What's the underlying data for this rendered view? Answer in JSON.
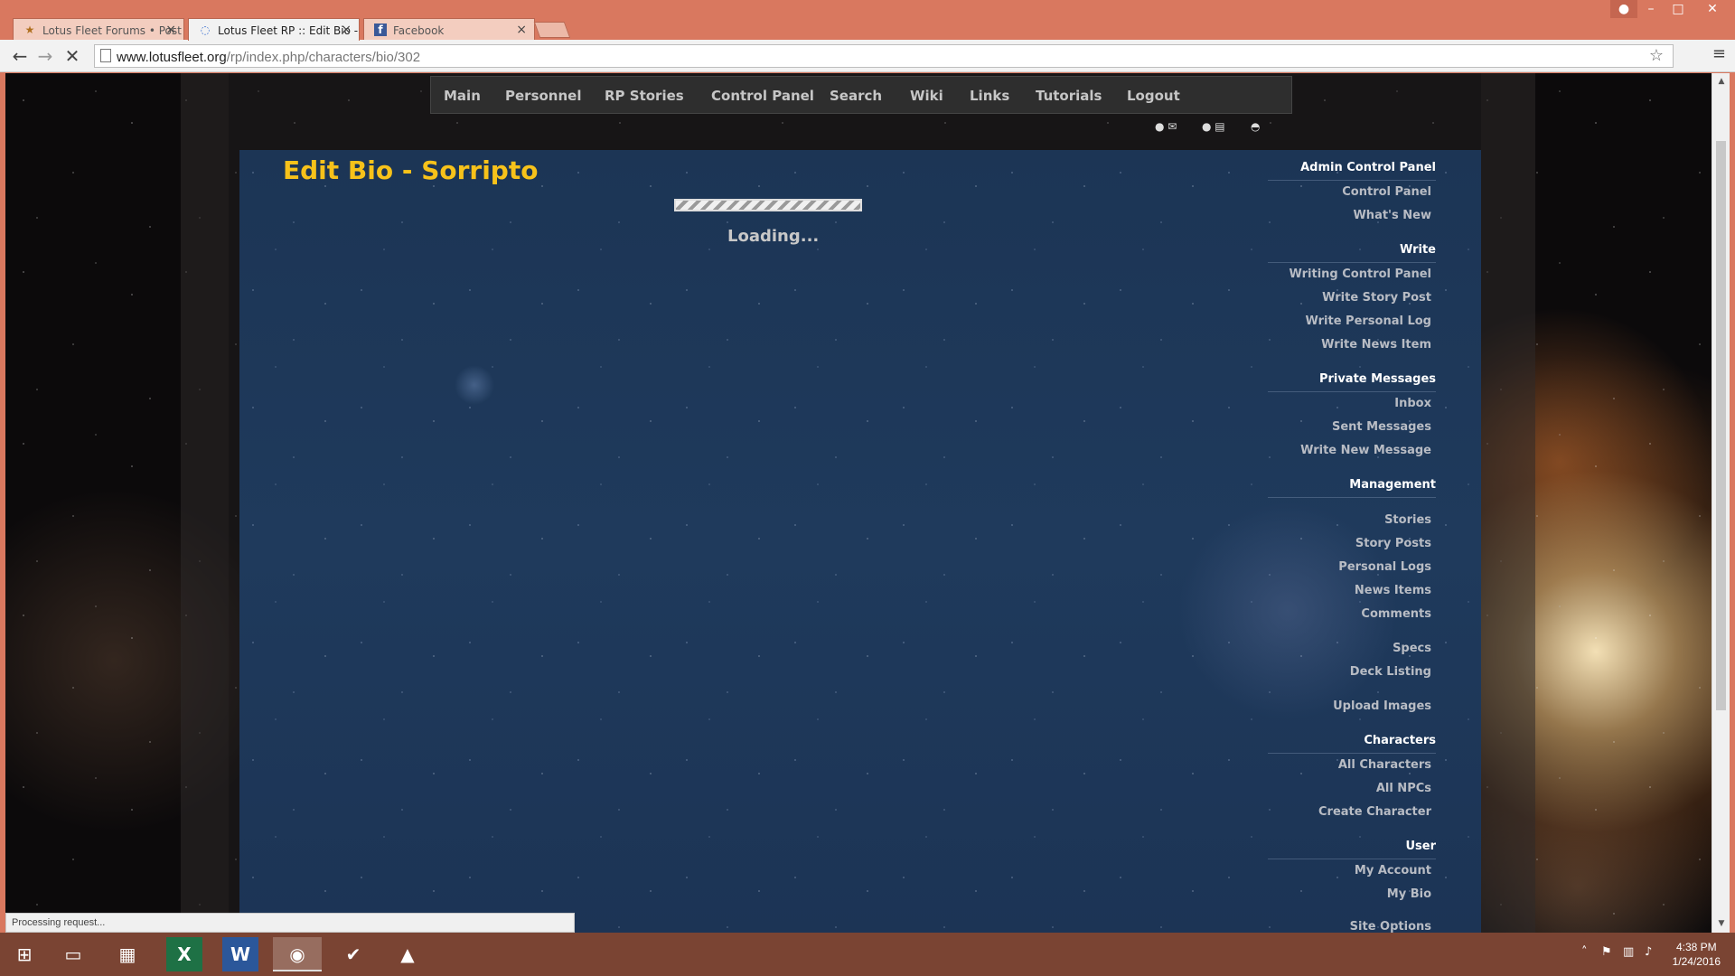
{
  "browser": {
    "tabs": [
      {
        "label": "Lotus Fleet Forums • Post",
        "icon": "star-favicon-icon"
      },
      {
        "label": "Lotus Fleet RP :: Edit Bio -",
        "icon": "loading-spinner-icon"
      },
      {
        "label": "Facebook",
        "icon": "facebook-favicon-icon"
      }
    ],
    "url_domain": "www.lotusfleet.org",
    "url_path": "/rp/index.php/characters/bio/302",
    "status_text": "Processing request..."
  },
  "nav": {
    "items": [
      "Main",
      "Personnel",
      "RP Stories",
      "Control Panel",
      "Search",
      "Wiki",
      "Links",
      "Tutorials",
      "Logout"
    ]
  },
  "page": {
    "title": "Edit Bio - Sorripto",
    "loading_text": "Loading..."
  },
  "sidebar": {
    "admin_head": "Admin Control Panel",
    "admin_control_panel": "Control Panel",
    "admin_whats_new": "What's New",
    "write_head": "Write",
    "writing_control_panel": "Writing Control Panel",
    "write_story_post": "Write Story Post",
    "write_personal_log": "Write Personal Log",
    "write_news_item": "Write News Item",
    "pm_head": "Private Messages",
    "pm_inbox": "Inbox",
    "pm_sent": "Sent Messages",
    "pm_new": "Write New Message",
    "mgmt_head": "Management",
    "mgmt_stories": "Stories",
    "mgmt_story_posts": "Story Posts",
    "mgmt_personal_logs": "Personal Logs",
    "mgmt_news_items": "News Items",
    "mgmt_comments": "Comments",
    "mgmt_specs": "Specs",
    "mgmt_deck_listing": "Deck Listing",
    "mgmt_upload_images": "Upload Images",
    "chars_head": "Characters",
    "chars_all": "All Characters",
    "chars_npcs": "All NPCs",
    "chars_create": "Create Character",
    "user_head": "User",
    "user_account": "My Account",
    "user_bio": "My Bio",
    "site_options": "Site Options"
  },
  "taskbar": {
    "time": "4:38 PM",
    "date": "1/24/2016"
  },
  "colors": {
    "title_accent": "#f7c21a",
    "content_bg": "#1f3a5c",
    "chrome_accent": "#d9785f"
  }
}
